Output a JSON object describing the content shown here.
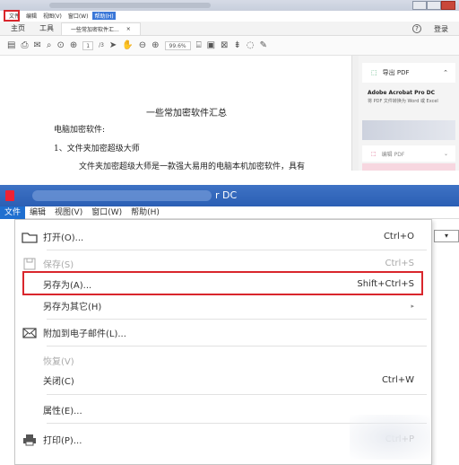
{
  "top": {
    "menu": [
      "文件",
      "编辑",
      "视图(V)",
      "窗口(W)",
      "帮助(H)"
    ],
    "tabs": {
      "home": "主页",
      "tools": "工具",
      "doc": "一些常加密软件汇...",
      "close": "×"
    },
    "login": "登录",
    "help": "?",
    "page": {
      "current": "1",
      "total": "/3"
    },
    "zoom": "99.6%",
    "doc": {
      "title": "一些常加密软件汇总",
      "line1": "电脑加密软件:",
      "line2": "1、文件夹加密超级大师",
      "line3": "文件夹加密超级大师是一款强大易用的电脑本机加密软件，具有"
    },
    "panel": {
      "export": "导出 PDF",
      "product": "Adobe Acrobat Pro DC",
      "desc": "将 PDF 文件转换为 Word 或 Excel",
      "edit": "编辑 PDF"
    }
  },
  "bottom": {
    "title": "r DC",
    "menu": [
      "文件",
      "编辑",
      "视图(V)",
      "窗口(W)",
      "帮助(H)"
    ],
    "items": [
      {
        "label": "打开(O)...",
        "shortcut": "Ctrl+O",
        "icon": "folder-icon",
        "disabled": false
      },
      {
        "label": "保存(S)",
        "shortcut": "Ctrl+S",
        "icon": "save-icon",
        "disabled": true
      },
      {
        "label": "另存为(A)...",
        "shortcut": "Shift+Ctrl+S",
        "icon": "",
        "disabled": false
      },
      {
        "label": "另存为其它(H)",
        "shortcut": "▸",
        "icon": "",
        "disabled": false
      },
      {
        "label": "附加到电子邮件(L)...",
        "shortcut": "",
        "icon": "email-icon",
        "disabled": false
      },
      {
        "label": "恢复(V)",
        "shortcut": "",
        "icon": "",
        "disabled": true
      },
      {
        "label": "关闭(C)",
        "shortcut": "Ctrl+W",
        "icon": "",
        "disabled": false
      },
      {
        "label": "属性(E)...",
        "shortcut": "",
        "icon": "",
        "disabled": false
      },
      {
        "label": "打印(P)...",
        "shortcut": "Ctrl+P",
        "icon": "print-icon",
        "disabled": false
      }
    ]
  }
}
